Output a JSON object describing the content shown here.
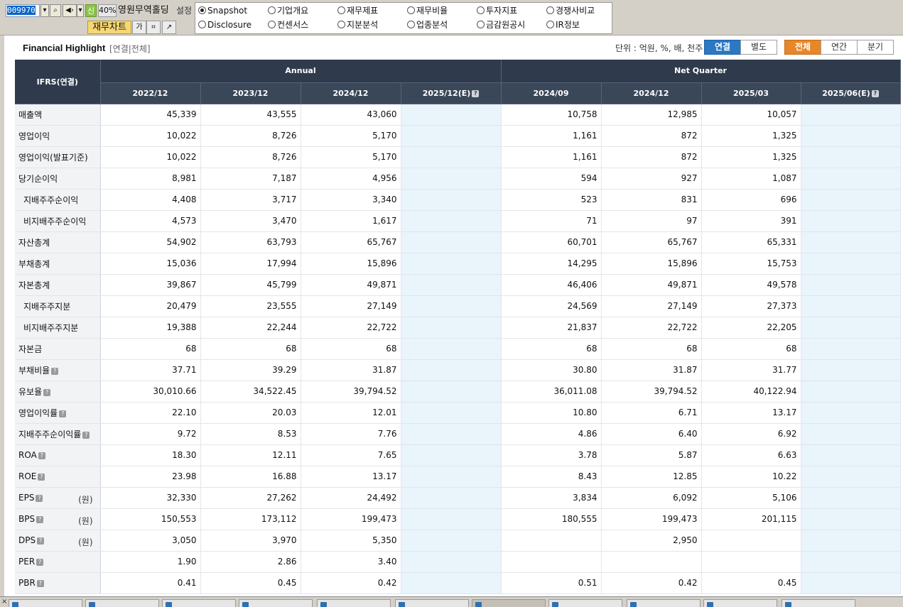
{
  "toolbar": {
    "code": "009970",
    "badge": "신",
    "percent": "40%",
    "company": "영원무역홀딩",
    "settings": "설정",
    "chart_button": "재무차트",
    "font_button": "가",
    "radio_options": [
      "Snapshot",
      "기업개요",
      "재무제표",
      "재무비율",
      "투자지표",
      "경쟁사비교",
      "Disclosure",
      "컨센서스",
      "지분분석",
      "업종분석",
      "금감원공시",
      "IR정보"
    ],
    "selected_option": "Snapshot"
  },
  "highlight": {
    "title": "Financial Highlight",
    "subtitle": "[연결|전체]",
    "unit": "단위 : 억원, %, 배, 천주",
    "basis_options": [
      "연결",
      "별도"
    ],
    "period_options": [
      "전체",
      "연간",
      "분기"
    ]
  },
  "table": {
    "corner": "IFRS(연결)",
    "group_annual": "Annual",
    "group_quarter": "Net Quarter",
    "columns": [
      "2022/12",
      "2023/12",
      "2024/12",
      "2025/12(E)",
      "2024/09",
      "2024/12",
      "2025/03",
      "2025/06(E)"
    ],
    "rows": [
      {
        "label": "매출액",
        "indent": false,
        "help": false,
        "unit": "",
        "values": [
          "45,339",
          "43,555",
          "43,060",
          "",
          "10,758",
          "12,985",
          "10,057",
          ""
        ]
      },
      {
        "label": "영업이익",
        "indent": false,
        "help": false,
        "unit": "",
        "values": [
          "10,022",
          "8,726",
          "5,170",
          "",
          "1,161",
          "872",
          "1,325",
          ""
        ]
      },
      {
        "label": "영업이익(발표기준)",
        "indent": false,
        "help": false,
        "unit": "",
        "values": [
          "10,022",
          "8,726",
          "5,170",
          "",
          "1,161",
          "872",
          "1,325",
          ""
        ]
      },
      {
        "label": "당기순이익",
        "indent": false,
        "help": false,
        "unit": "",
        "values": [
          "8,981",
          "7,187",
          "4,956",
          "",
          "594",
          "927",
          "1,087",
          ""
        ]
      },
      {
        "label": "지배주주순이익",
        "indent": true,
        "help": false,
        "unit": "",
        "values": [
          "4,408",
          "3,717",
          "3,340",
          "",
          "523",
          "831",
          "696",
          ""
        ]
      },
      {
        "label": "비지배주주순이익",
        "indent": true,
        "help": false,
        "unit": "",
        "values": [
          "4,573",
          "3,470",
          "1,617",
          "",
          "71",
          "97",
          "391",
          ""
        ]
      },
      {
        "label": "자산총계",
        "indent": false,
        "help": false,
        "unit": "",
        "values": [
          "54,902",
          "63,793",
          "65,767",
          "",
          "60,701",
          "65,767",
          "65,331",
          ""
        ]
      },
      {
        "label": "부채총계",
        "indent": false,
        "help": false,
        "unit": "",
        "values": [
          "15,036",
          "17,994",
          "15,896",
          "",
          "14,295",
          "15,896",
          "15,753",
          ""
        ]
      },
      {
        "label": "자본총계",
        "indent": false,
        "help": false,
        "unit": "",
        "values": [
          "39,867",
          "45,799",
          "49,871",
          "",
          "46,406",
          "49,871",
          "49,578",
          ""
        ]
      },
      {
        "label": "지배주주지분",
        "indent": true,
        "help": false,
        "unit": "",
        "values": [
          "20,479",
          "23,555",
          "27,149",
          "",
          "24,569",
          "27,149",
          "27,373",
          ""
        ]
      },
      {
        "label": "비지배주주지분",
        "indent": true,
        "help": false,
        "unit": "",
        "values": [
          "19,388",
          "22,244",
          "22,722",
          "",
          "21,837",
          "22,722",
          "22,205",
          ""
        ]
      },
      {
        "label": "자본금",
        "indent": false,
        "help": false,
        "unit": "",
        "values": [
          "68",
          "68",
          "68",
          "",
          "68",
          "68",
          "68",
          ""
        ]
      },
      {
        "label": "부채비율",
        "indent": false,
        "help": true,
        "unit": "",
        "values": [
          "37.71",
          "39.29",
          "31.87",
          "",
          "30.80",
          "31.87",
          "31.77",
          ""
        ]
      },
      {
        "label": "유보율",
        "indent": false,
        "help": true,
        "unit": "",
        "values": [
          "30,010.66",
          "34,522.45",
          "39,794.52",
          "",
          "36,011.08",
          "39,794.52",
          "40,122.94",
          ""
        ]
      },
      {
        "label": "영업이익률",
        "indent": false,
        "help": true,
        "unit": "",
        "values": [
          "22.10",
          "20.03",
          "12.01",
          "",
          "10.80",
          "6.71",
          "13.17",
          ""
        ]
      },
      {
        "label": "지배주주순이익률",
        "indent": false,
        "help": true,
        "unit": "",
        "values": [
          "9.72",
          "8.53",
          "7.76",
          "",
          "4.86",
          "6.40",
          "6.92",
          ""
        ]
      },
      {
        "label": "ROA",
        "indent": false,
        "help": true,
        "unit": "",
        "values": [
          "18.30",
          "12.11",
          "7.65",
          "",
          "3.78",
          "5.87",
          "6.63",
          ""
        ]
      },
      {
        "label": "ROE",
        "indent": false,
        "help": true,
        "unit": "",
        "values": [
          "23.98",
          "16.88",
          "13.17",
          "",
          "8.43",
          "12.85",
          "10.22",
          ""
        ]
      },
      {
        "label": "EPS",
        "indent": false,
        "help": true,
        "unit": "(원)",
        "values": [
          "32,330",
          "27,262",
          "24,492",
          "",
          "3,834",
          "6,092",
          "5,106",
          ""
        ]
      },
      {
        "label": "BPS",
        "indent": false,
        "help": true,
        "unit": "(원)",
        "values": [
          "150,553",
          "173,112",
          "199,473",
          "",
          "180,555",
          "199,473",
          "201,115",
          ""
        ]
      },
      {
        "label": "DPS",
        "indent": false,
        "help": true,
        "unit": "(원)",
        "values": [
          "3,050",
          "3,970",
          "5,350",
          "",
          "",
          "2,950",
          "",
          ""
        ]
      },
      {
        "label": "PER",
        "indent": false,
        "help": true,
        "unit": "",
        "values": [
          "1.90",
          "2.86",
          "3.40",
          "",
          "",
          "",
          "",
          ""
        ]
      },
      {
        "label": "PBR",
        "indent": false,
        "help": true,
        "unit": "",
        "values": [
          "0.41",
          "0.45",
          "0.42",
          "",
          "0.51",
          "0.42",
          "0.45",
          ""
        ]
      }
    ]
  },
  "bottom_tabs": [
    "",
    "",
    "",
    "",
    "",
    "",
    "",
    "",
    "",
    "",
    ""
  ],
  "colors": {
    "header_bg": "#2f3b4c",
    "estimate_bg": "#e9f4fb",
    "blue_toggle": "#2b78c4",
    "orange_toggle": "#e8872a"
  }
}
